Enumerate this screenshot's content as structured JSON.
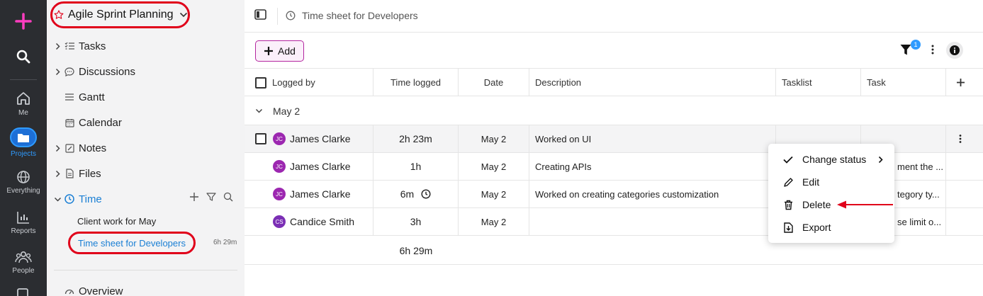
{
  "rail": {
    "items": [
      {
        "label": "",
        "icon": "plus-icon"
      },
      {
        "label": "",
        "icon": "search-icon"
      },
      {
        "label": "Me",
        "icon": "home-icon"
      },
      {
        "label": "Projects",
        "icon": "folder-icon"
      },
      {
        "label": "Everything",
        "icon": "globe-icon"
      },
      {
        "label": "Reports",
        "icon": "bar-chart-icon"
      },
      {
        "label": "People",
        "icon": "people-icon"
      }
    ],
    "accent": "#2f9bff"
  },
  "sidebar": {
    "project_title": "Agile Sprint Planning",
    "nav": [
      {
        "label": "Tasks",
        "icon": "checklist-icon"
      },
      {
        "label": "Discussions",
        "icon": "chat-icon"
      },
      {
        "label": "Gantt",
        "icon": "gantt-icon"
      },
      {
        "label": "Calendar",
        "icon": "calendar-icon"
      },
      {
        "label": "Notes",
        "icon": "note-icon"
      },
      {
        "label": "Files",
        "icon": "file-icon"
      },
      {
        "label": "Time",
        "icon": "clock-icon"
      }
    ],
    "time_sub": [
      {
        "label": "Client work for May"
      },
      {
        "label": "Time sheet for Developers",
        "total": "6h 29m"
      }
    ],
    "overview": "Overview"
  },
  "header": {
    "breadcrumb": "Time sheet for Developers"
  },
  "toolbar": {
    "add_label": "Add",
    "filter_count": "1"
  },
  "table": {
    "columns": [
      "Logged by",
      "Time logged",
      "Date",
      "Description",
      "Tasklist",
      "Task"
    ],
    "group_label": "May 2",
    "rows": [
      {
        "initials": "JC",
        "name": "James Clarke",
        "time": "2h 23m",
        "date": "May 2",
        "description": "Worked on UI",
        "task": ""
      },
      {
        "initials": "JC",
        "name": "James Clarke",
        "time": "1h",
        "date": "May 2",
        "description": "Creating APIs",
        "task": "ment the ..."
      },
      {
        "initials": "JC",
        "name": "James Clarke",
        "time": "6m",
        "date": "May 2",
        "description": "Worked on creating categories customization",
        "task": "tegory ty..."
      },
      {
        "initials": "CS",
        "name": "Candice Smith",
        "time": "3h",
        "date": "May 2",
        "description": "",
        "task": "se limit o..."
      }
    ],
    "total": "6h 29m",
    "avatar_colors": {
      "JC": "#9c27b0",
      "CS": "#7b2fb5"
    }
  },
  "context_menu": {
    "items": [
      {
        "label": "Change status",
        "icon": "check-icon"
      },
      {
        "label": "Edit",
        "icon": "pencil-icon"
      },
      {
        "label": "Delete",
        "icon": "trash-icon"
      },
      {
        "label": "Export",
        "icon": "export-icon"
      }
    ]
  },
  "annotation_color": "#e0001a"
}
